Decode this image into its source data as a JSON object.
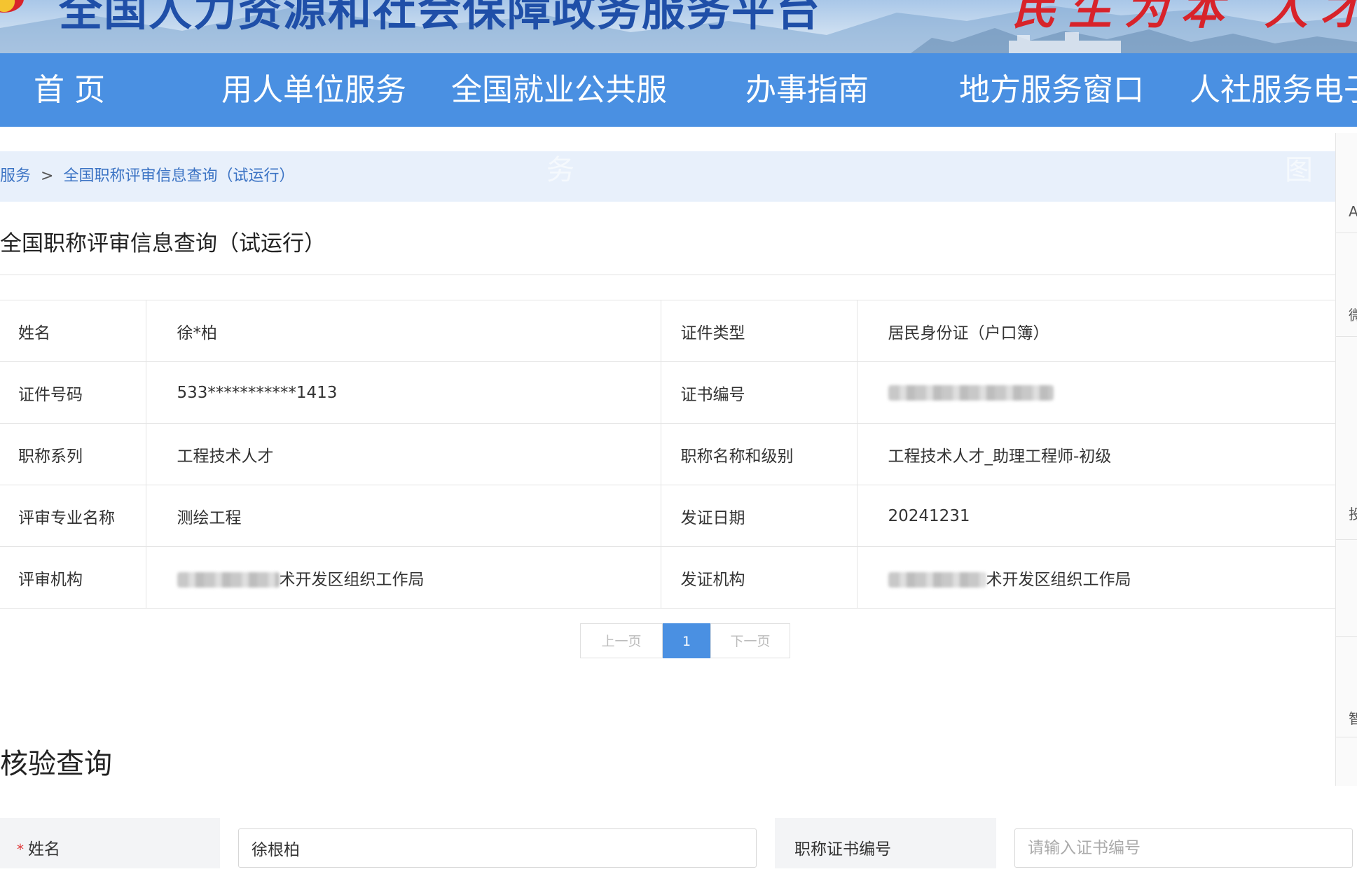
{
  "banner": {
    "title": "全国人力资源和社会保障政务服务平台",
    "slogan": "民生为本 人才优先"
  },
  "nav": {
    "items": [
      "首 页",
      "用人单位服务",
      "全国就业公共服",
      "办事指南",
      "地方服务窗口",
      "人社服务电子"
    ],
    "overflow": [
      "务",
      "图"
    ]
  },
  "breadcrumb": {
    "parent": "服务",
    "separator": ">",
    "current": "全国职称评审信息查询（试运行）"
  },
  "page_title": "全国职称评审信息查询（试运行）",
  "record": {
    "rows": [
      {
        "label1": "姓名",
        "value1": "徐*柏",
        "label2": "证件类型",
        "value2": "居民身份证（户口簿）"
      },
      {
        "label1": "证件号码",
        "value1": "533***********1413",
        "label2": "证书编号",
        "value2": ""
      },
      {
        "label1": "职称系列",
        "value1": "工程技术人才",
        "label2": "职称名称和级别",
        "value2": "工程技术人才_助理工程师-初级"
      },
      {
        "label1": "评审专业名称",
        "value1": "测绘工程",
        "label2": "发证日期",
        "value2": "20241231"
      },
      {
        "label1": "评审机构",
        "value1": "术开发区组织工作局",
        "label2": "发证机构",
        "value2": "术开发区组织工作局"
      }
    ]
  },
  "pagination": {
    "prev": "上一页",
    "current": "1",
    "next": "下一页"
  },
  "verify": {
    "title": "核验查询",
    "required_mark": "*",
    "name_label": "姓名",
    "name_value": "徐根柏",
    "cert_label": "职称证书编号",
    "cert_placeholder": "请输入证书编号"
  },
  "side": {
    "items": [
      "A",
      "微",
      "投",
      "智"
    ]
  }
}
